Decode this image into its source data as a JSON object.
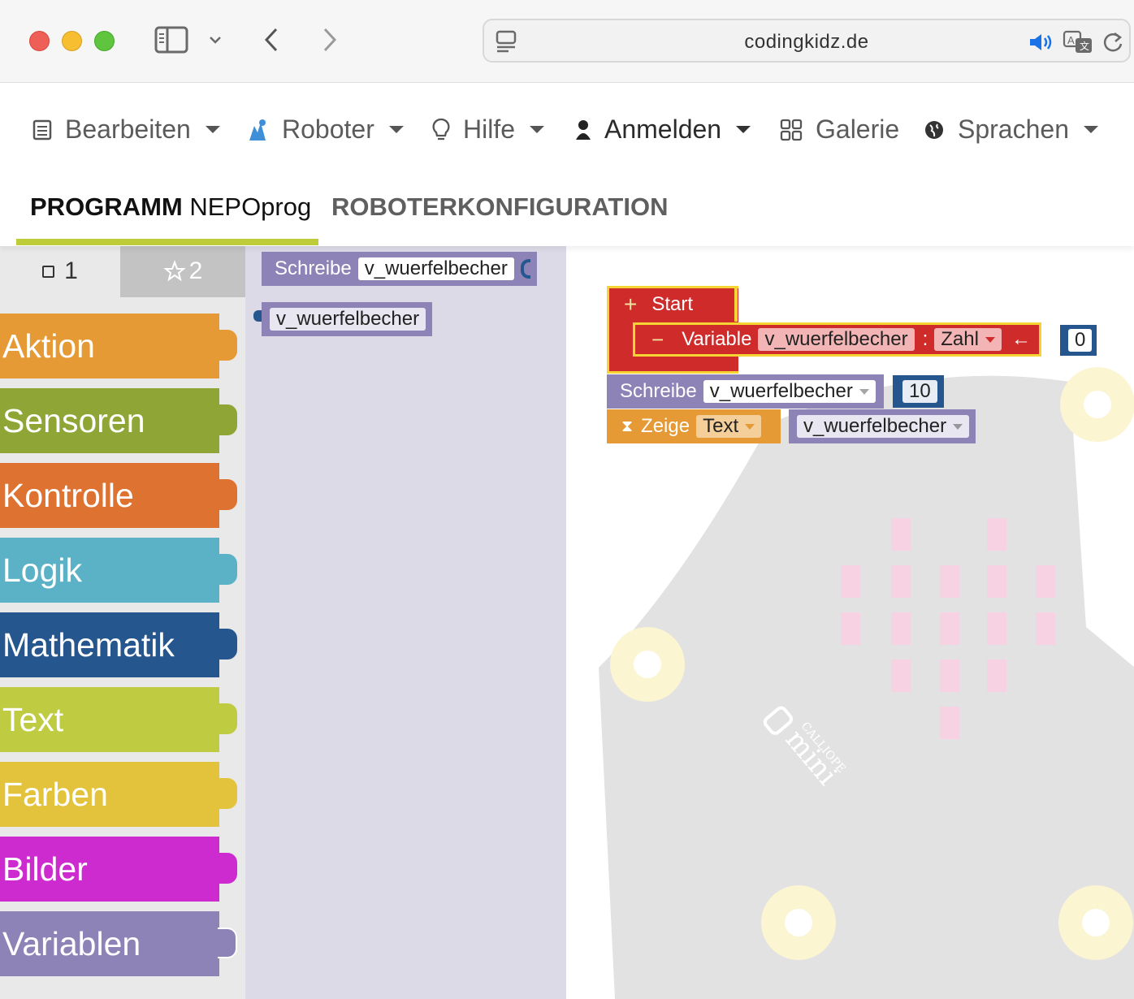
{
  "browser": {
    "url": "codingkidz.de",
    "icons": [
      "sidebar-icon",
      "chevron-down-icon",
      "back-icon",
      "forward-icon",
      "reader-icon",
      "speaker-icon",
      "translate-icon",
      "reload-icon"
    ]
  },
  "nav": {
    "items": [
      {
        "label": "Bearbeiten",
        "icon": "document-icon"
      },
      {
        "label": "Roboter",
        "icon": "robot-icon"
      },
      {
        "label": "Hilfe",
        "icon": "lightbulb-icon"
      },
      {
        "label": "Anmelden",
        "icon": "user-icon"
      },
      {
        "label": "Galerie",
        "icon": "gallery-icon"
      },
      {
        "label": "Sprachen",
        "icon": "globe-icon"
      }
    ]
  },
  "tabs": {
    "program_bold": "PROGRAMM",
    "program_name": " NEPOprog",
    "config": "ROBOTERKONFIGURATION"
  },
  "toolbox": {
    "level1": "1",
    "level2": "2",
    "categories": [
      {
        "label": "Aktion",
        "color": "#e59a35"
      },
      {
        "label": "Sensoren",
        "color": "#8fa535"
      },
      {
        "label": "Kontrolle",
        "color": "#de7230"
      },
      {
        "label": "Logik",
        "color": "#5bb2c6"
      },
      {
        "label": "Mathematik",
        "color": "#25568e"
      },
      {
        "label": "Text",
        "color": "#bfcc42"
      },
      {
        "label": "Farben",
        "color": "#e4c33c"
      },
      {
        "label": "Bilder",
        "color": "#cd2bcf"
      },
      {
        "label": "Variablen",
        "color": "#8d83b6"
      }
    ]
  },
  "flyout": {
    "write_label": "Schreibe",
    "write_var": "v_wuerfelbecher",
    "var_block": "v_wuerfelbecher"
  },
  "workspace": {
    "start_label": "Start",
    "variable_label": "Variable",
    "variable_name": "v_wuerfelbecher",
    "colon": ":",
    "variable_type": "Zahl",
    "arrow": "←",
    "variable_init": "0",
    "write_label": "Schreibe",
    "write_var": "v_wuerfelbecher",
    "write_value": "10",
    "show_label": "Zeige",
    "show_type": "Text",
    "show_var": "v_wuerfelbecher",
    "board_logo_text": "CALLIOPE mini"
  },
  "colors": {
    "start_block": "#cf2b2a",
    "start_highlight": "#f5d533",
    "variables": "#8d83b6",
    "math": "#25568e",
    "action": "#e59a35",
    "tab_underline": "#bfcc3a"
  }
}
